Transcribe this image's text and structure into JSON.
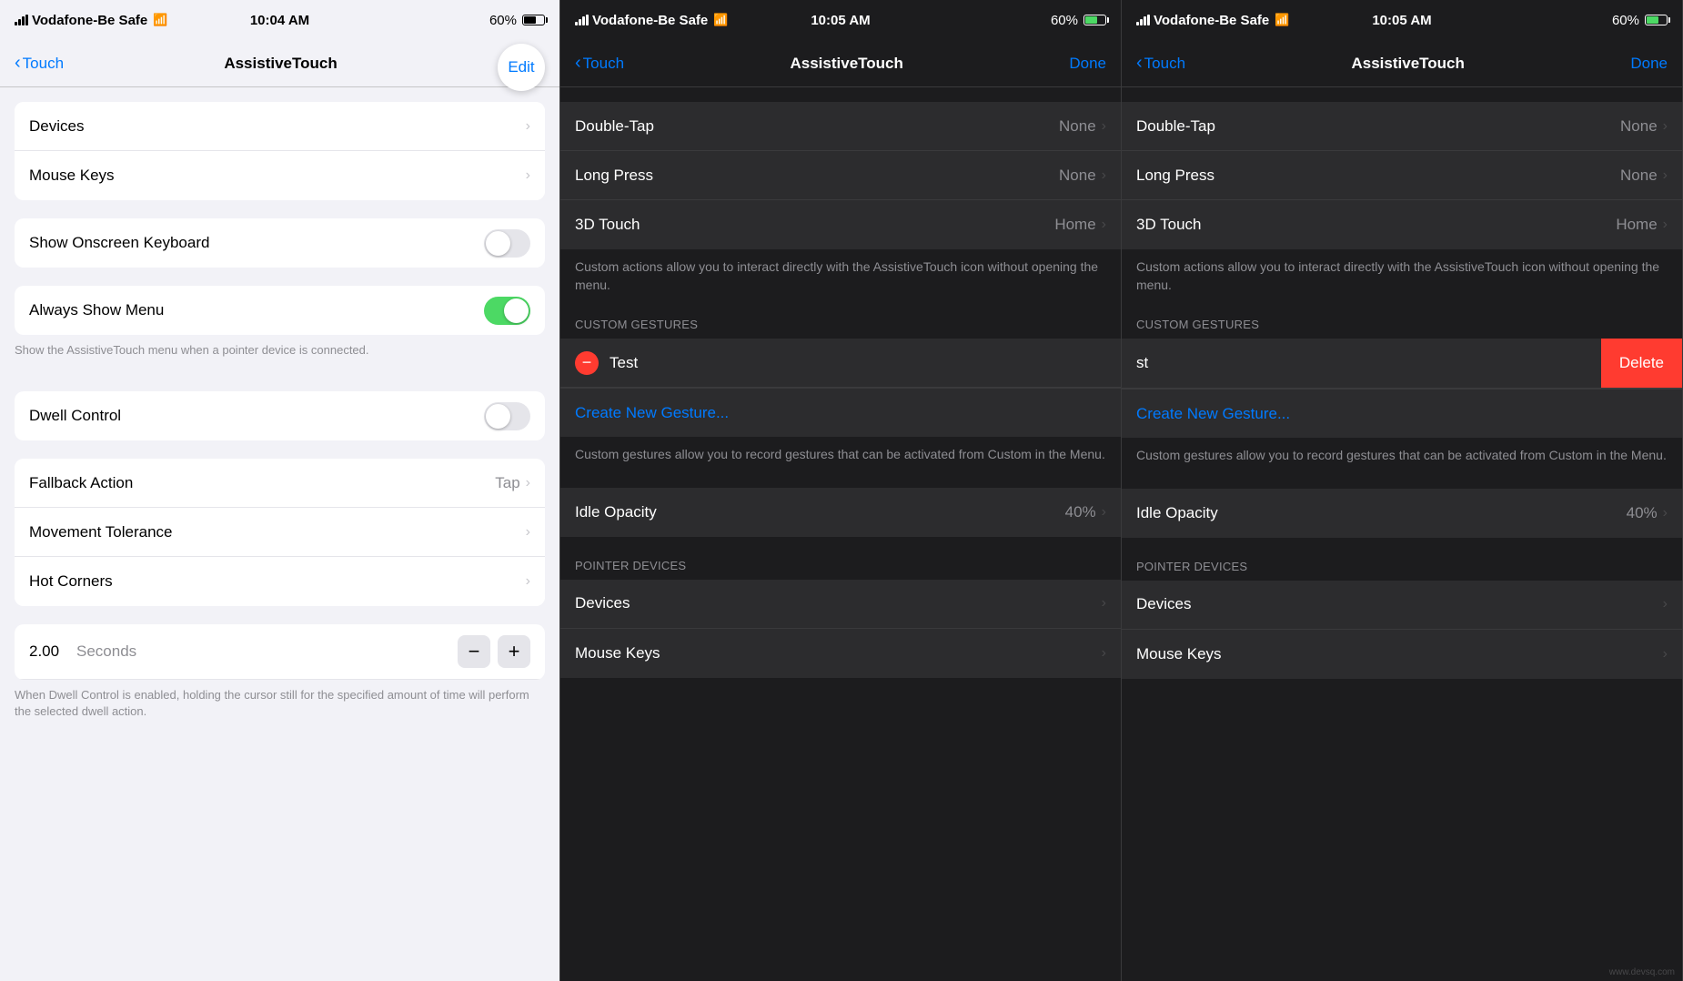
{
  "panels": [
    {
      "id": "panel1",
      "theme": "light",
      "statusBar": {
        "carrier": "Vodafone-Be Safe",
        "time": "10:04 AM",
        "battery": "60%",
        "charging": false
      },
      "nav": {
        "back": "Touch",
        "title": "AssistiveTouch",
        "action": "Edit",
        "actionStyle": "circle"
      },
      "rows": [
        {
          "label": "Devices",
          "value": "",
          "hasChevron": true,
          "toggle": null
        },
        {
          "label": "Mouse Keys",
          "value": "",
          "hasChevron": true,
          "toggle": null
        },
        {
          "label": "Show Onscreen Keyboard",
          "value": "",
          "hasChevron": false,
          "toggle": "off"
        },
        {
          "label": "Always Show Menu",
          "value": "",
          "hasChevron": false,
          "toggle": "on",
          "note": "Show the AssistiveTouch menu when a pointer device is connected."
        },
        {
          "label": "Dwell Control",
          "value": "",
          "hasChevron": false,
          "toggle": "off"
        },
        {
          "label": "Fallback Action",
          "value": "Tap",
          "hasChevron": true,
          "toggle": null
        },
        {
          "label": "Movement Tolerance",
          "value": "",
          "hasChevron": true,
          "toggle": null
        },
        {
          "label": "Hot Corners",
          "value": "",
          "hasChevron": true,
          "toggle": null
        }
      ],
      "stepper": {
        "value": "2.00",
        "label": "Seconds",
        "minus": "−",
        "plus": "+"
      },
      "dwellNote": "When Dwell Control is enabled, holding the cursor still for the specified amount of time will perform the selected dwell action."
    },
    {
      "id": "panel2",
      "theme": "dark",
      "statusBar": {
        "carrier": "Vodafone-Be Safe",
        "time": "10:05 AM",
        "battery": "60%",
        "charging": true
      },
      "nav": {
        "back": "Touch",
        "title": "AssistiveTouch",
        "action": "Done",
        "actionStyle": "text"
      },
      "customActionsRows": [
        {
          "label": "Double-Tap",
          "value": "None",
          "hasChevron": true
        },
        {
          "label": "Long Press",
          "value": "None",
          "hasChevron": true
        },
        {
          "label": "3D Touch",
          "value": "Home",
          "hasChevron": true
        }
      ],
      "customActionsNote": "Custom actions allow you to interact directly with the AssistiveTouch icon without opening the menu.",
      "customGesturesHeader": "CUSTOM GESTURES",
      "gestures": [
        {
          "label": "Test",
          "hasDelete": false,
          "showMinus": true
        }
      ],
      "createGestureLabel": "Create New Gesture...",
      "customGesturesNote": "Custom gestures allow you to record gestures that can be activated from Custom in the Menu.",
      "idleOpacity": {
        "label": "Idle Opacity",
        "value": "40%",
        "hasChevron": true
      },
      "pointerDevicesHeader": "POINTER DEVICES",
      "pointerRows": [
        {
          "label": "Devices",
          "value": "",
          "hasChevron": true
        },
        {
          "label": "Mouse Keys",
          "value": "",
          "hasChevron": true
        }
      ]
    },
    {
      "id": "panel3",
      "theme": "dark",
      "statusBar": {
        "carrier": "Vodafone-Be Safe",
        "time": "10:05 AM",
        "battery": "60%",
        "charging": true
      },
      "nav": {
        "back": "Touch",
        "title": "AssistiveTouch",
        "action": "Done",
        "actionStyle": "text"
      },
      "customActionsRows": [
        {
          "label": "Double-Tap",
          "value": "None",
          "hasChevron": true
        },
        {
          "label": "Long Press",
          "value": "None",
          "hasChevron": true
        },
        {
          "label": "3D Touch",
          "value": "Home",
          "hasChevron": true
        }
      ],
      "customActionsNote": "Custom actions allow you to interact directly with the AssistiveTouch icon without opening the menu.",
      "customGesturesHeader": "CUSTOM GESTURES",
      "gestures": [
        {
          "label": "st",
          "hasDelete": true,
          "showMinus": false
        }
      ],
      "deleteLabel": "Delete",
      "createGestureLabel": "Create New Gesture...",
      "customGesturesNote": "Custom gestures allow you to record gestures that can be activated from Custom in the Menu.",
      "idleOpacity": {
        "label": "Idle Opacity",
        "value": "40%",
        "hasChevron": true
      },
      "pointerDevicesHeader": "POINTER DEVICES",
      "pointerRows": [
        {
          "label": "Devices",
          "value": "",
          "hasChevron": true
        },
        {
          "label": "Mouse Keys",
          "value": "",
          "hasChevron": true
        }
      ],
      "watermark": "www.devsq.com"
    }
  ]
}
